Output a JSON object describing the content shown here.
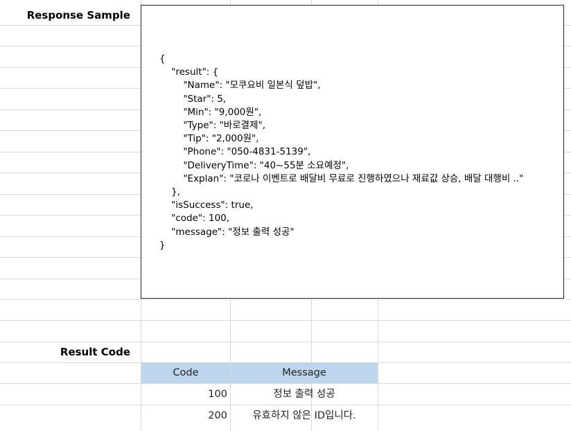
{
  "labels": {
    "response_sample": "Response Sample",
    "result_code": "Result Code"
  },
  "response_json_lines": [
    "{",
    "    \"result\": {",
    "        \"Name\": \"모쿠요비 일본식 덮밥\",",
    "        \"Star\": 5,",
    "        \"Min\": \"9,000원\",",
    "        \"Type\": \"바로결제\",",
    "        \"Tip\": \"2,000원\",",
    "        \"Phone\": \"050-4831-5139\",",
    "        \"DeliveryTime\": \"40~55분 소요예정\",",
    "        \"Explan\": \"코로나 이벤트로 배달비 무료로 진행하였으나 재료값 상승, 배달 대행비 ..\"",
    "    },",
    "    \"isSuccess\": true,",
    "    \"code\": 100,",
    "    \"message\": \"정보 출력 성공\"",
    "}"
  ],
  "result_table": {
    "headers": [
      "Code",
      "Message"
    ],
    "rows": [
      {
        "code": "100",
        "message": "정보 출력 성공"
      },
      {
        "code": "200",
        "message": "유효하지 않은 ID입니다."
      }
    ]
  },
  "colors": {
    "header_fill": "#bcd6ee",
    "gridline": "#dadada",
    "box_border": "#222222"
  }
}
